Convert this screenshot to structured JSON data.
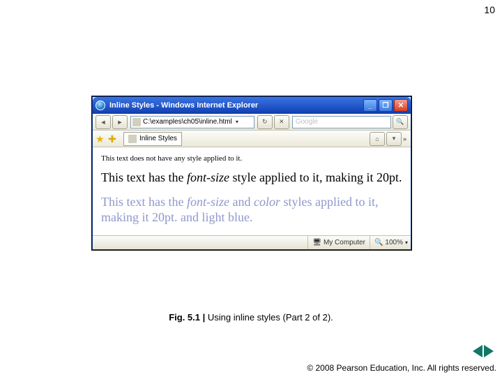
{
  "page_number": "10",
  "window": {
    "title": "Inline Styles - Windows Internet Explorer",
    "address": "C:\\examples\\ch05\\inline.html",
    "search_placeholder": "Google",
    "tab_label": "Inline Styles",
    "toolbar_overflow": "»"
  },
  "body": {
    "paragraph1": "This text does not have any style applied to it.",
    "paragraph2_a": "This text has the ",
    "paragraph2_i": "font-size",
    "paragraph2_b": " style applied to it, making it 20pt.",
    "paragraph3_a": "This text has the ",
    "paragraph3_i1": "font-size",
    "paragraph3_b": " and ",
    "paragraph3_i2": "color",
    "paragraph3_c": " styles applied to it, making it 20pt. and light blue."
  },
  "statusbar": {
    "zone": "My Computer",
    "zoom": "100%"
  },
  "caption": {
    "label": "Fig. 5.1 |",
    "text": " Using inline styles (Part 2 of 2)."
  },
  "copyright": "© 2008 Pearson Education, Inc.  All rights reserved."
}
